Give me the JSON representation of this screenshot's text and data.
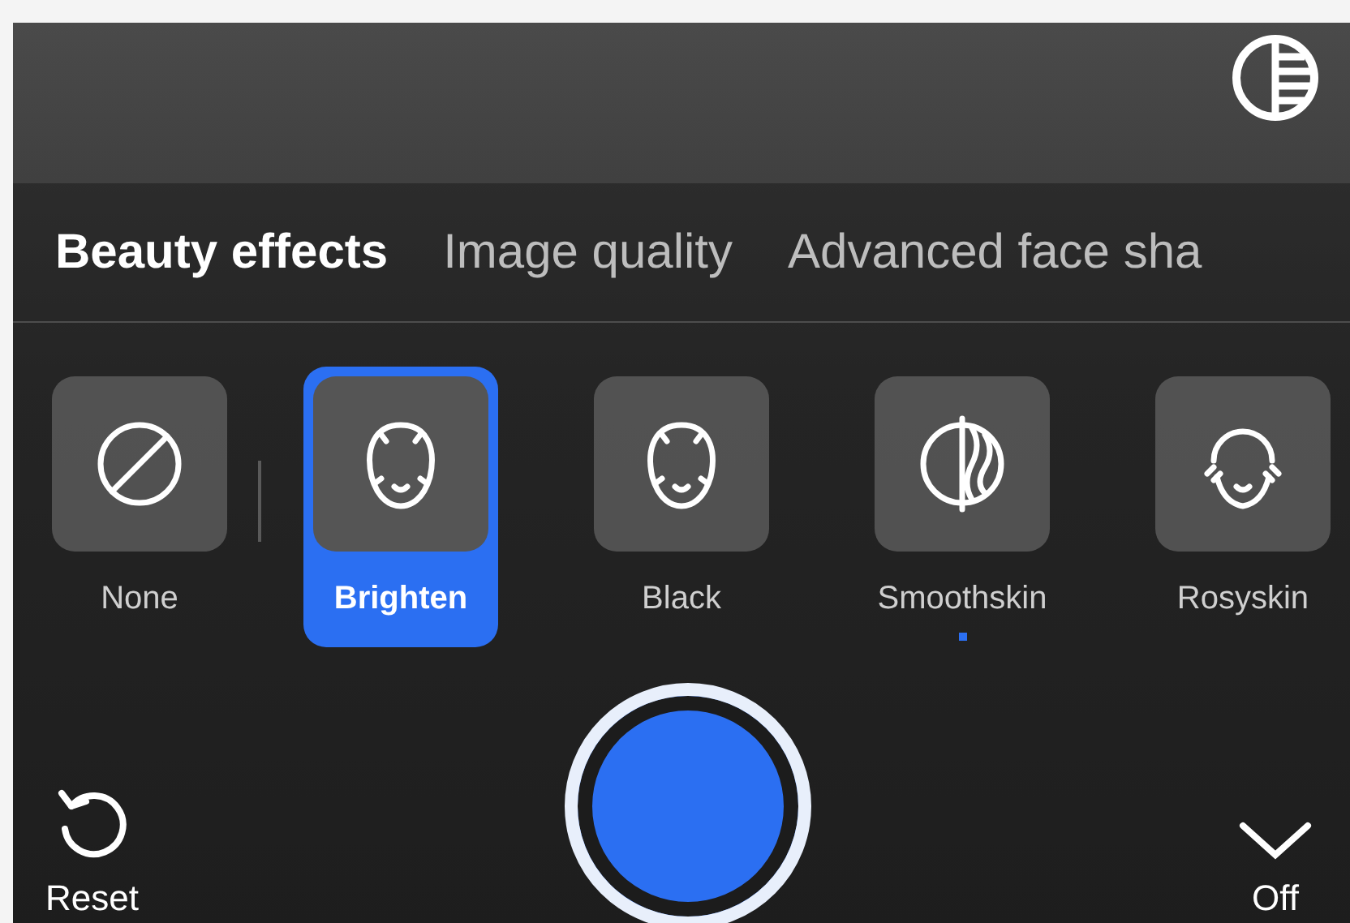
{
  "tabs": [
    {
      "label": "Beauty effects",
      "selected": true
    },
    {
      "label": "Image quality",
      "selected": false
    },
    {
      "label": "Advanced face sha",
      "selected": false
    }
  ],
  "effects": [
    {
      "label": "None",
      "kind": "none",
      "selected": false,
      "adjusted": false
    },
    {
      "label": "Brighten",
      "kind": "face",
      "selected": true,
      "adjusted": false
    },
    {
      "label": "Black",
      "kind": "face",
      "selected": false,
      "adjusted": false
    },
    {
      "label": "Smoothskin",
      "kind": "smooth",
      "selected": false,
      "adjusted": true
    },
    {
      "label": "Rosyskin",
      "kind": "rosy",
      "selected": false,
      "adjusted": false
    }
  ],
  "reset": {
    "label": "Reset"
  },
  "toggle": {
    "label": "Off"
  }
}
